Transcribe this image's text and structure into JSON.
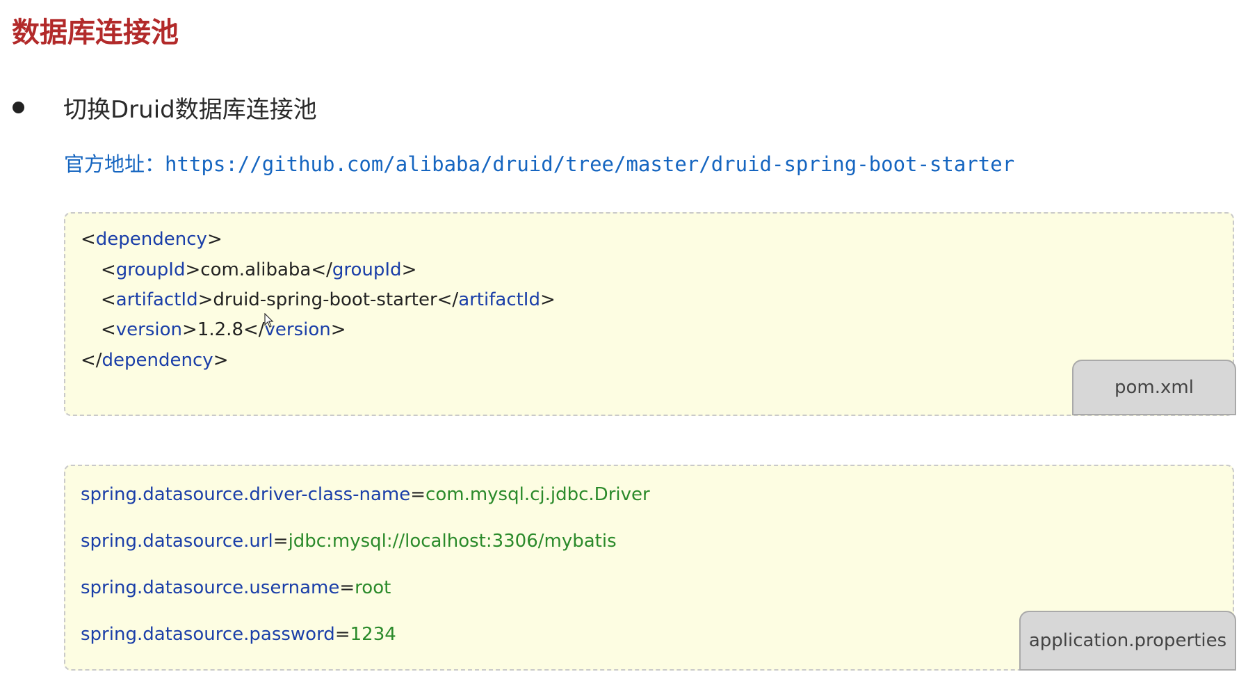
{
  "title": "数据库连接池",
  "bullet": "切换Druid数据库连接池",
  "official": {
    "label": "官方地址：",
    "url": "https://github.com/alibaba/druid/tree/master/druid-spring-boot-starter"
  },
  "pom": {
    "lines": {
      "l1": {
        "open": "<",
        "tag": "dependency",
        "close": ">"
      },
      "l2": {
        "open": "<",
        "tag": "groupId",
        "mid_open": ">",
        "value": "com.alibaba",
        "end_open": "</",
        "end_tag": "groupId",
        "end_close": ">"
      },
      "l3": {
        "open": "<",
        "tag": "artifactId",
        "mid_open": ">",
        "value": "druid-spring-boot-starter",
        "end_open": "</",
        "end_tag": "artifactId",
        "end_close": ">"
      },
      "l4": {
        "open": "<",
        "tag": "version",
        "mid_open": ">",
        "value": "1.2.8",
        "end_open": "</",
        "end_tag": "version",
        "end_close": ">"
      },
      "l5": {
        "open": "</",
        "tag": "dependency",
        "close": ">"
      }
    },
    "file_label": "pom.xml"
  },
  "props": {
    "lines": [
      {
        "key": "spring.datasource.driver-class-name",
        "eq": "=",
        "value": "com.mysql.cj.jdbc.Driver"
      },
      {
        "key": "spring.datasource.url",
        "eq": "=",
        "value": "jdbc:mysql://localhost:3306/mybatis"
      },
      {
        "key": "spring.datasource.username",
        "eq": "=",
        "value": "root"
      },
      {
        "key": "spring.datasource.password",
        "eq": "=",
        "value": "1234"
      }
    ],
    "file_label": "application.properties"
  },
  "colors": {
    "title": "#b22a2a",
    "link": "#1565c0",
    "tag": "#1a3ea8",
    "value_green": "#2a8a2a",
    "box_bg": "#fdfde2",
    "tab_bg": "#d7d7d7"
  }
}
